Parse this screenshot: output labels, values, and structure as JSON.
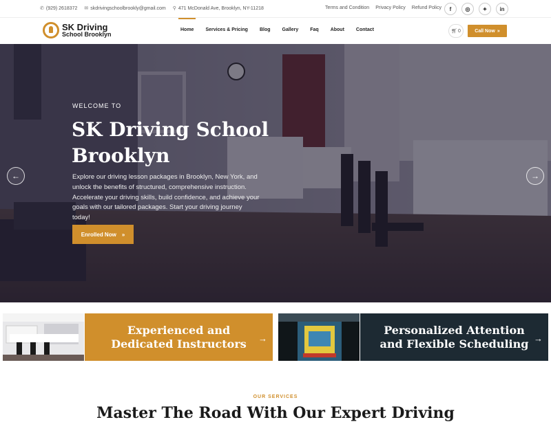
{
  "topbar": {
    "phone": "(929) 2618372",
    "email": "skdrivingschoolbrookly@gmail.com",
    "address": "471 McDonald Ave, Brooklyn, NY-11218",
    "policies": [
      "Terms and Condition",
      "Privacy Policy",
      "Refund Policy"
    ],
    "social": [
      {
        "icon": "facebook-icon",
        "glyph": "f"
      },
      {
        "icon": "instagram-icon",
        "glyph": "◎"
      },
      {
        "icon": "twitter-icon",
        "glyph": "✦"
      },
      {
        "icon": "linkedin-icon",
        "glyph": "in"
      }
    ]
  },
  "logo": {
    "line1": "SK Driving",
    "line2": "School Brooklyn"
  },
  "nav": {
    "items": [
      "Home",
      "Services & Pricing",
      "Blog",
      "Gallery",
      "Faq",
      "About",
      "Contact"
    ],
    "active": "Home",
    "cart_count": "0",
    "call_label": "Call Now"
  },
  "hero": {
    "eyebrow": "WELCOME TO",
    "title": "SK Driving School Brooklyn",
    "description": "Explore our driving lesson packages in Brooklyn, New York, and unlock the benefits of structured, comprehensive instruction. Accelerate your driving skills, build confidence, and achieve your goals with our tailored packages. Start your driving journey today!",
    "cta": "Enrolled Now",
    "prev": "←",
    "next": "→"
  },
  "features": [
    {
      "title": "Experienced and Dedicated Instructors",
      "color": "#d08f2c"
    },
    {
      "title": "Personalized Attention and Flexible Scheduling",
      "color": "#1d2a33"
    }
  ],
  "services": {
    "eyebrow": "OUR SERVICES",
    "title": "Master The Road With Our Expert Driving"
  }
}
